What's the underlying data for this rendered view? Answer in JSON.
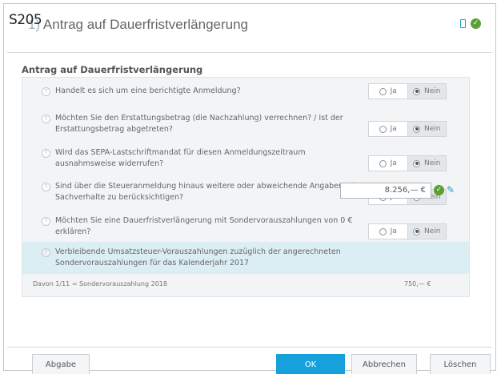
{
  "screen_id": "S205",
  "window": {
    "title_number": "1)",
    "title": "Antrag auf Dauerfristverlängerung"
  },
  "panel": {
    "title": "Antrag auf Dauerfristverlängerung",
    "questions": [
      {
        "text": "Handelt es sich um eine berichtigte Anmeldung?",
        "yes_label": "Ja",
        "no_label": "Nein",
        "selected": "no"
      },
      {
        "text": "Möchten Sie den Erstattungsbetrag (die Nachzahlung) verrechnen? / Ist der Erstattungsbetrag abgetreten?",
        "yes_label": "Ja",
        "no_label": "Nein",
        "selected": "no"
      },
      {
        "text": "Wird das SEPA-Lastschriftmandat für diesen Anmeldungszeitraum ausnahmsweise widerrufen?",
        "yes_label": "Ja",
        "no_label": "Nein",
        "selected": "no"
      },
      {
        "text": "Sind über die Steueranmeldung hinaus weitere oder abweichende Angaben oder Sachverhalte zu berücksichtigen?",
        "yes_label": "Ja",
        "no_label": "Nein",
        "selected": "no"
      },
      {
        "text": "Möchten Sie eine Dauerfristverlängerung mit Sondervorauszahlungen von 0 € erklären?",
        "yes_label": "Ja",
        "no_label": "Nein",
        "selected": "no"
      }
    ],
    "amount_question": "Verbleibende Umsatzsteuer-Vorauszahlungen zuzüglich der angerechneten Sondervorauszahlungen für das Kalenderjahr 2017",
    "amount_value": "8.256,— €",
    "sub_label": "Davon 1/11 = Sondervorauszahlung 2018",
    "sub_amount": "750,— €"
  },
  "buttons": {
    "abgabe": "Abgabe",
    "ok": "OK",
    "abbrechen": "Abbrechen",
    "loeschen": "Löschen"
  },
  "colors": {
    "accent": "#16a1dd",
    "success": "#5ba033",
    "highlight_row": "#dbeef4"
  }
}
